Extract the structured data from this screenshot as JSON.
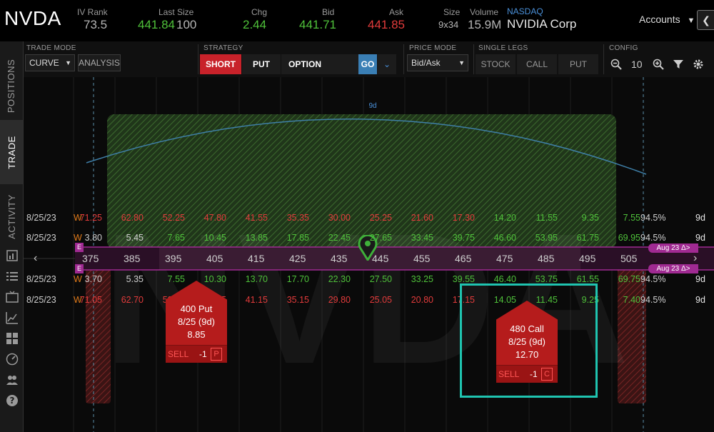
{
  "header": {
    "symbol": "NVDA",
    "iv_rank": {
      "label": "IV Rank",
      "value": "73.5"
    },
    "last_size": {
      "label": "Last Size",
      "price": "441.84",
      "size": "100"
    },
    "chg": {
      "label": "Chg",
      "value": "2.44"
    },
    "bid": {
      "label": "Bid",
      "value": "441.71"
    },
    "ask": {
      "label": "Ask",
      "value": "441.85"
    },
    "size": {
      "label": "Size",
      "value": "9x34"
    },
    "volume": {
      "label": "Volume",
      "value": "15.9M"
    },
    "exchange": "NASDAQ",
    "company": "NVIDIA Corp",
    "accounts_label": "Accounts"
  },
  "left_tabs": {
    "positions": "POSITIONS",
    "trade": "TRADE",
    "activity": "ACTIVITY"
  },
  "toolbar": {
    "trade_mode_label": "TRADE MODE",
    "trade_mode_value": "CURVE",
    "analysis_label": "ANALYSIS",
    "strategy_label": "STRATEGY",
    "short_label": "SHORT",
    "put_label": "PUT",
    "option_label": "OPTION",
    "go_label": "GO",
    "price_mode_label": "PRICE MODE",
    "price_mode_value": "Bid/Ask",
    "single_legs_label": "SINGLE LEGS",
    "stock_label": "STOCK",
    "call_label": "CALL",
    "put_leg_label": "PUT",
    "config_label": "CONFIG",
    "config_value": "10"
  },
  "chart": {
    "watermark": "NVDA",
    "curve_label": "9d",
    "strikes": [
      "375",
      "385",
      "395",
      "405",
      "415",
      "425",
      "435",
      "445",
      "455",
      "465",
      "475",
      "485",
      "495",
      "505"
    ],
    "expiry_flag_top": "Aug 23 Δ>",
    "expiry_flag_bottom": "Aug 23 Δ>",
    "e_marker": "E",
    "rows": [
      {
        "date": "8/25/23",
        "w": "W",
        "iv": "94.5%",
        "days": "9d",
        "values": [
          "71.25",
          "62.80",
          "52.25",
          "47.80",
          "41.55",
          "35.35",
          "30.00",
          "25.25",
          "21.60",
          "17.30",
          "14.20",
          "11.55",
          "9.35",
          "7.55"
        ]
      },
      {
        "date": "8/25/23",
        "w": "W",
        "iv": "94.5%",
        "days": "9d",
        "values": [
          "3.80",
          "5.45",
          "7.65",
          "10.45",
          "13.85",
          "17.85",
          "22.45",
          "27.65",
          "33.45",
          "39.75",
          "46.60",
          "53.95",
          "61.75",
          "69.95"
        ]
      },
      {
        "date": "8/25/23",
        "w": "W",
        "iv": "94.5%",
        "days": "9d",
        "values": [
          "3.70",
          "5.35",
          "7.55",
          "10.30",
          "13.70",
          "17.70",
          "22.30",
          "27.50",
          "33.25",
          "39.55",
          "46.40",
          "53.75",
          "61.55",
          "69.75"
        ]
      },
      {
        "date": "8/25/23",
        "w": "W",
        "iv": "94.5%",
        "days": "9d",
        "values": [
          "71.05",
          "62.70",
          "52.10",
          "47.75",
          "41.15",
          "35.15",
          "29.80",
          "25.05",
          "20.80",
          "17.15",
          "14.05",
          "11.45",
          "9.25",
          "7.40"
        ]
      }
    ],
    "put_card": {
      "title": "400 Put",
      "expiry": "8/25 (9d)",
      "price": "8.85",
      "action": "SELL",
      "qty": "-1",
      "tag": "P"
    },
    "call_card": {
      "title": "480 Call",
      "expiry": "8/25 (9d)",
      "price": "12.70",
      "action": "SELL",
      "qty": "-1",
      "tag": "C"
    }
  },
  "colors": {
    "accent_green": "#4fc13a",
    "accent_red": "#e23b3b",
    "card_red": "#b51c1c",
    "highlight_teal": "#1fc4b0",
    "strike_band": "#7a1a6e"
  }
}
